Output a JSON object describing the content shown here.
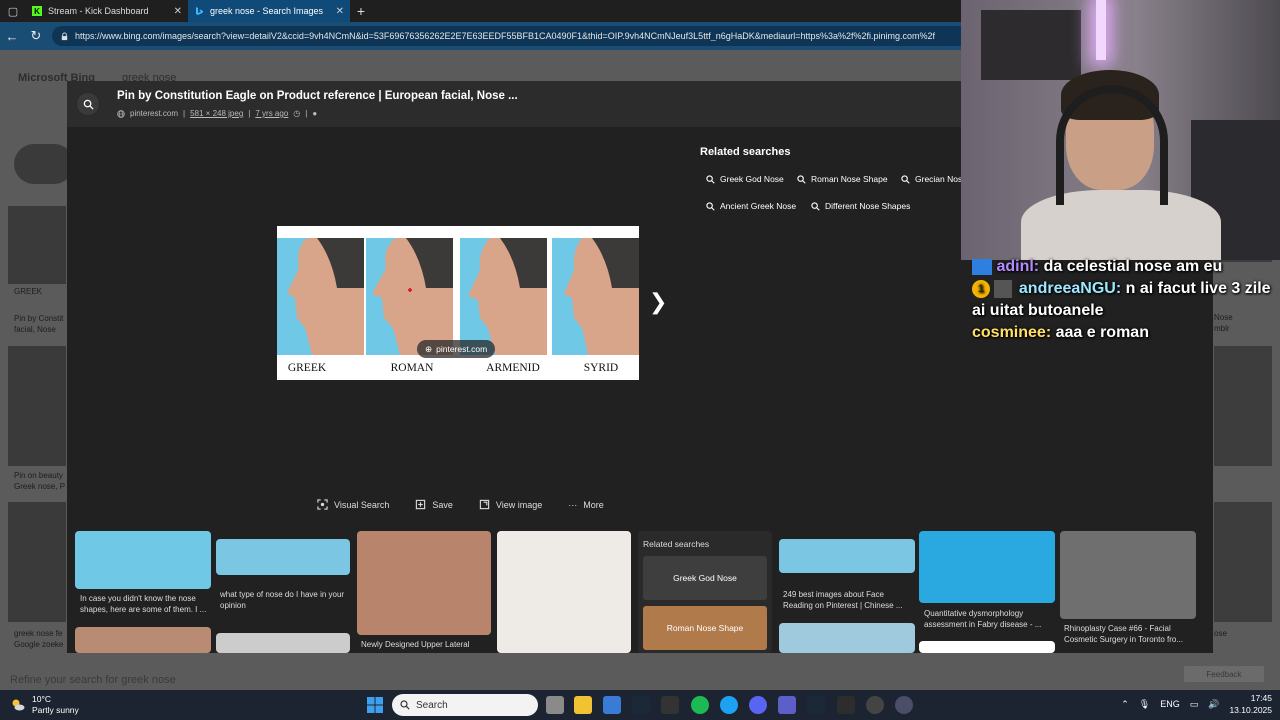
{
  "browser": {
    "tabs": [
      {
        "title": "Stream - Kick Dashboard",
        "icon": "kick-icon"
      },
      {
        "title": "greek nose - Search Images",
        "icon": "bing-icon"
      }
    ],
    "url": "https://www.bing.com/images/search?view=detailV2&ccid=9vh4NCmN&id=53F69676356262E2E7E63EEDF55BFB1CA0490F1&thid=OIP.9vh4NCmNJeuf3L5ttf_n6gHaDK&mediaurl=https%3a%2f%2fi.pinimg.com%2f"
  },
  "background_page": {
    "logo": "Microsoft Bing",
    "query": "greek nose",
    "left_captions": [
      "GREEK",
      "Pin by Constit facial, Nose",
      "Pin on beauty Greek nose, P",
      "greek nose fe Google zoeke"
    ],
    "right_captions": [
      "Nose",
      "mblr",
      "ose"
    ],
    "refine": "Refine your search for greek nose",
    "feedback": "Feedback"
  },
  "modal": {
    "title": "Pin by Constitution Eagle on Product reference | European facial, Nose ...",
    "source": "pinterest.com",
    "dimensions": "581 × 248 jpeg",
    "age": "7 yrs ago",
    "image_labels": [
      "GREEK",
      "ROMAN",
      "ARMENID",
      "SYRID"
    ],
    "image_source_chip": "pinterest.com",
    "related_title": "Related searches",
    "related": [
      "Greek God Nose",
      "Roman Nose Shape",
      "Grecian Nose",
      "Ancient Greek Nose",
      "Different Nose Shapes"
    ],
    "actions": [
      "Visual Search",
      "Save",
      "View image",
      "More"
    ],
    "thumb_captions": [
      "In case you didn't know the nose shapes, here are some of them. I ...",
      "what type of nose do I have in your opinion",
      "Newly Designed Upper Lateral",
      "249 best images about Face Reading on Pinterest | Chinese ...",
      "Quantitative dysmorphology assessment in Fabry disease - ...",
      "Rhinoplasty Case #66 - Facial Cosmetic Surgery in Toronto fro..."
    ],
    "thumb_related_title": "Related searches",
    "thumb_related": [
      "Greek God Nose",
      "Roman Nose Shape"
    ]
  },
  "chat": [
    {
      "user": "adinl:",
      "message": "da celestial nose am eu"
    },
    {
      "user": "andreeaNGU:",
      "message": "n ai facut live 3 zile ai uitat butoanele",
      "badge": "1"
    },
    {
      "user": "cosminee:",
      "message": "aaa e roman"
    }
  ],
  "taskbar": {
    "temperature": "10°C",
    "weather": "Partly sunny",
    "search_placeholder": "Search",
    "lang": "ENG",
    "time": "17:45",
    "date": "13.10.2025"
  }
}
